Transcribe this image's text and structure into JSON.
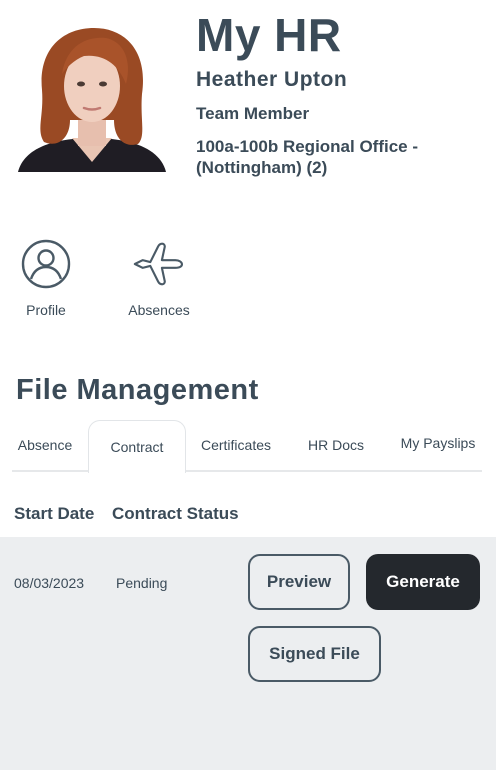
{
  "header": {
    "app_title": "My HR",
    "user_name": "Heather Upton",
    "role": "Team Member",
    "office": "100a-100b Regional Office - (Nottingham) (2)",
    "avatar": "employee-photo"
  },
  "quick_links": [
    {
      "label": "Profile",
      "icon": "user-circle-icon"
    },
    {
      "label": "Absences",
      "icon": "airplane-icon"
    }
  ],
  "file_management": {
    "title": "File Management",
    "tabs": [
      "Absence",
      "Contract",
      "Certificates",
      "HR Docs",
      "My Payslips"
    ],
    "active_tab": "Contract",
    "columns": [
      "Start Date",
      "Contract Status"
    ],
    "rows": [
      {
        "start_date": "08/03/2023",
        "status": "Pending",
        "actions": {
          "preview": "Preview",
          "generate": "Generate",
          "signed_file": "Signed File"
        }
      }
    ]
  },
  "colors": {
    "text": "#3b4b58",
    "dark_button": "#24282d",
    "row_bg": "#eceef0"
  }
}
